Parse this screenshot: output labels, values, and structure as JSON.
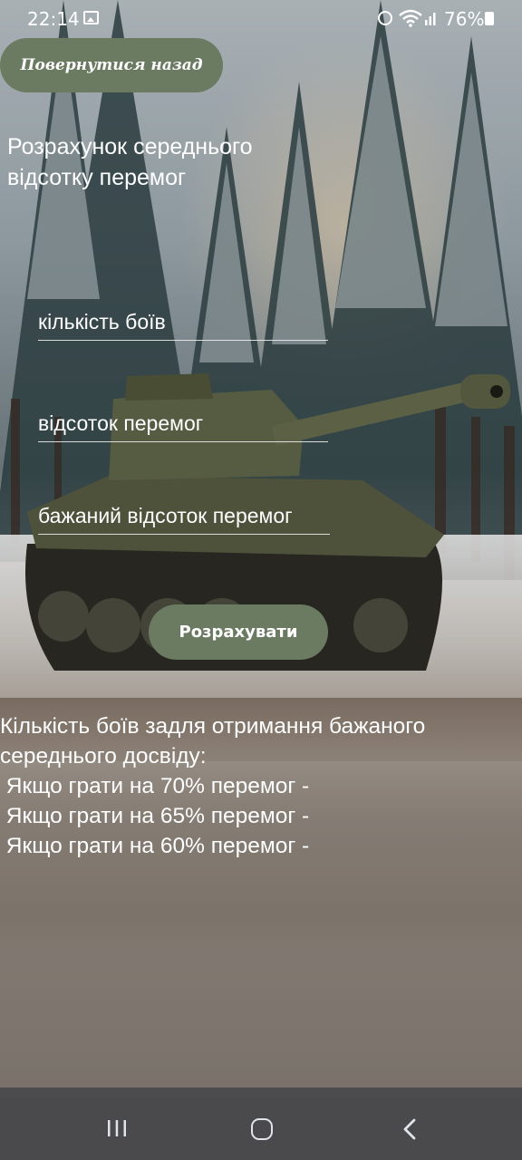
{
  "status_bar": {
    "time": "22:14",
    "battery": "76%",
    "icons": [
      "gallery-icon",
      "alarm-icon",
      "wifi-icon",
      "signal-icon",
      "battery-icon"
    ]
  },
  "back_button": {
    "label": "Повернутися назад"
  },
  "title": "Розрахунок середнього відсотку перемог",
  "form": {
    "battles_placeholder": "кількість боїв",
    "winrate_placeholder": "відсоток перемог",
    "desired_placeholder": "бажаний відсоток перемог"
  },
  "calculate_button": {
    "label": "Розрахувати"
  },
  "result": {
    "heading_line1": "Кількість боїв задля отримання бажаного",
    "heading_line2": "середнього досвіду:",
    "line_70": " Якщо грати на 70% перемог -",
    "line_65": " Якщо грати на 65% перемог -",
    "line_60": " Якщо грати на 60% перемог -"
  },
  "nav_bar": {
    "icons": [
      "recent-apps-icon",
      "home-icon",
      "back-icon"
    ]
  },
  "colors": {
    "button": "#6b7b62",
    "text": "#ffffff",
    "nav": "#282d37"
  }
}
